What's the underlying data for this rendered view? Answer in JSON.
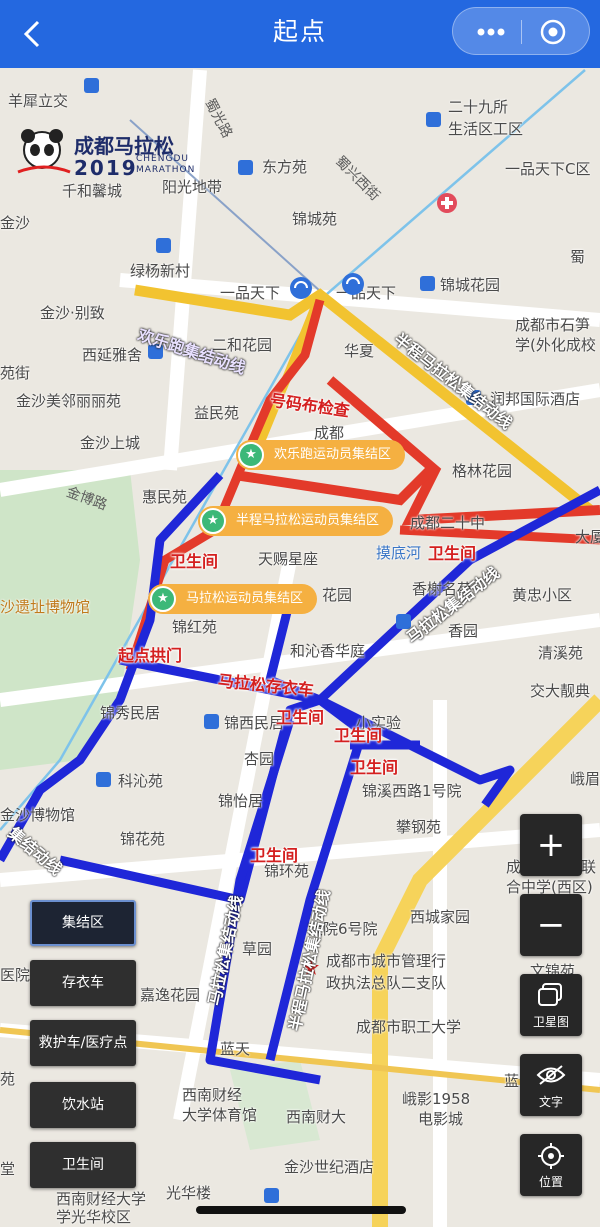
{
  "header": {
    "title": "起点"
  },
  "logo": {
    "name": "成都马拉松",
    "year": "2019",
    "sub": "CHENGDU MARATHON"
  },
  "pins": [
    {
      "label": "欢乐跑运动员集结区"
    },
    {
      "label": "半程马拉松运动员集结区"
    },
    {
      "label": "马拉松运动员集结区"
    }
  ],
  "route_labels": {
    "fun_run_route": "欢乐跑集结动线",
    "checkpoint": "号码布检查",
    "toilet": "卫生间",
    "start_arch": "起点拱门",
    "bag_truck": "马拉松存衣车",
    "half_route": "半程马拉松集结动线",
    "full_route": "马拉松集结动线",
    "assembly_route": "集结动线"
  },
  "places": {
    "yangxi": "羊犀立交",
    "shuguanglu": "蜀光路",
    "sanshijiu": "二十九所",
    "shenghuo": "生活区工区",
    "dongfang": "东方苑",
    "shuxingxi": "蜀兴西街",
    "yipintianxia_c": "一品天下C区",
    "qianhe": "千和馨城",
    "yangguang": "阳光地带",
    "jinsha": "金沙",
    "jincheng": "锦城苑",
    "lvyang": "绿杨新村",
    "yipintianxia": "一品天下",
    "yitianxia": "一品天下",
    "jinchenghuayuan": "锦城花园",
    "shu": "蜀",
    "jinshabieyun": "金沙·别致",
    "erhe": "二和花园",
    "cdshishi": "成都市石笋",
    "waiguoyu": "学(外化成校",
    "xixiya": "西延雅舍",
    "huaxia": "华夏",
    "yuanchuan": "苑街",
    "jinshameilin": "金沙美邻丽丽苑",
    "runbang": "润邦国际酒店",
    "yimin": "益民苑",
    "jinshashangcheng": "金沙上城",
    "cheng": "成都",
    "gelin": "格林花园",
    "jinbo": "金博路",
    "huimin": "惠民苑",
    "cd20": "成都二十中",
    "tiansheng": "天赐星座",
    "modi": "摸底河",
    "huangzhong": "黄忠小区",
    "dasha": "大厦",
    "yizhi": "沙遗址博物馆",
    "xiangshu": "香榭名苑",
    "hua": "花园",
    "jinhong": "锦红苑",
    "hexiang": "和沁香华庭",
    "xiangyuan": "香园",
    "qingxi": "清溪苑",
    "jiaoda": "交大靓典",
    "jinxiumin": "锦秀民居",
    "jinximin": "锦西民居",
    "shiyan": "小实验",
    "xingyuan": "杏园",
    "eroshi": "峨眉",
    "kexin": "科沁苑",
    "jinxi1": "锦溪西路1号院",
    "bowuguan": "金沙博物馆",
    "jinyi": "锦怡居",
    "panggang": "攀钢苑",
    "jinhuayuan": "锦花苑",
    "shiren": "成都市石室联",
    "shiren2": "合中学(西区)",
    "jinhuan": "锦环苑",
    "xichengjiayuan": "西城家园",
    "yiyuan": "医院",
    "caoyuan": "草园",
    "yuan6": "大院6号院",
    "chengguan": "成都市城市管理行",
    "chengguan2": "政执法总队二支队",
    "wenjin": "文锦苑",
    "jiayi": "嘉逸花园",
    "zhiye": "成都市职工大学",
    "lanjing": "蓝景",
    "landian": "蓝天",
    "xinanjingcai": "西南财经",
    "tiyuguan": "大学体育馆",
    "xinancaida": "西南财大",
    "emei1958": "峨影1958",
    "dianyingcheng": "电影城",
    "jinshashiji": "金沙世纪酒店",
    "guanghualou": "光华楼",
    "xincaiguanghua": "西南财经大学",
    "guanghuaxiaoqu": "学光华校区",
    "tang": "堂",
    "yuan": "苑"
  },
  "legend": [
    {
      "label": "集结区",
      "active": true
    },
    {
      "label": "存衣车",
      "active": false
    },
    {
      "label": "救护车/医疗点",
      "active": false
    },
    {
      "label": "饮水站",
      "active": false
    },
    {
      "label": "卫生间",
      "active": false
    }
  ],
  "controls": {
    "zoom_in": "+",
    "zoom_out": "−",
    "satellite": "卫星图",
    "text": "文字",
    "locate": "位置"
  }
}
